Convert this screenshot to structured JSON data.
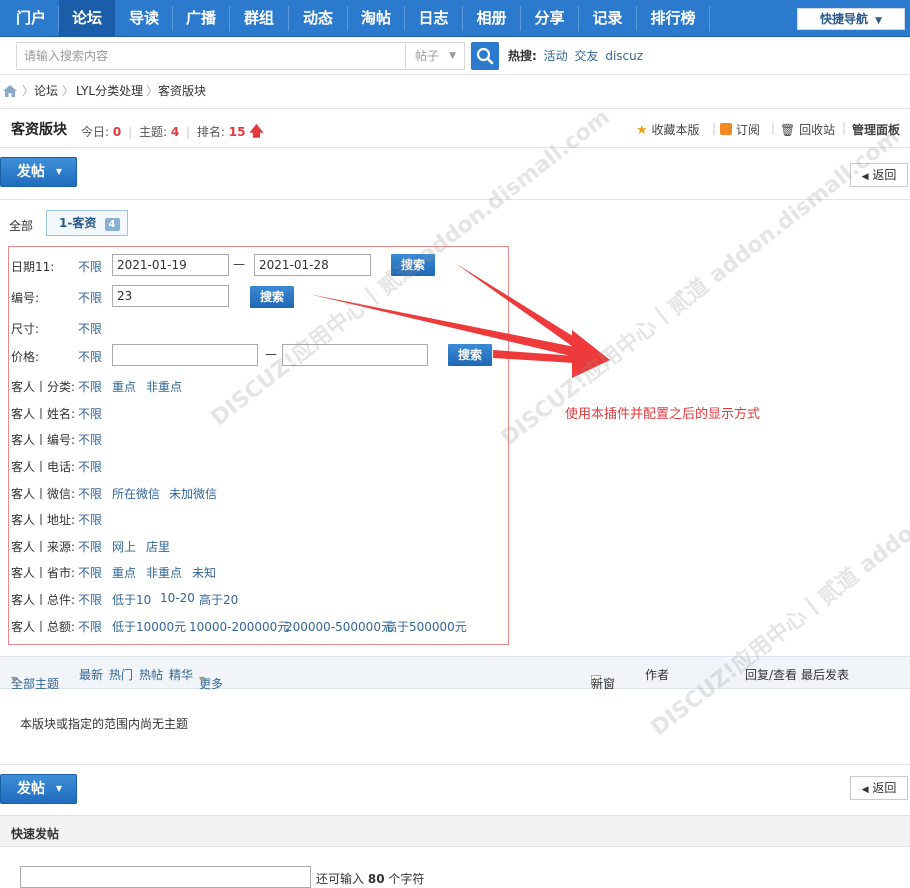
{
  "nav": {
    "items": [
      "门户",
      "论坛",
      "导读",
      "广播",
      "群组",
      "动态",
      "淘帖",
      "日志",
      "相册",
      "分享",
      "记录",
      "排行榜"
    ],
    "quick_nav": "快捷导航"
  },
  "search": {
    "placeholder": "请输入搜索内容",
    "type": "帖子",
    "hot_label": "热搜:",
    "hot_items": [
      "活动",
      "交友",
      "discuz"
    ]
  },
  "breadcrumb": [
    "论坛",
    "LYL分类处理",
    "客资版块"
  ],
  "forum": {
    "title": "客资版块",
    "today_label": "今日:",
    "today": "0",
    "topics_label": "主题:",
    "topics": "4",
    "rank_label": "排名:",
    "rank": "15",
    "favorite": "收藏本版",
    "subscribe": "订阅",
    "recycle": "回收站",
    "manage": "管理面板"
  },
  "actions": {
    "post": "发帖",
    "back": "返回"
  },
  "tabs": {
    "all": "全部",
    "current": "1-客资",
    "current_count": "4"
  },
  "filter": {
    "date": {
      "label": "日期11:",
      "any": "不限",
      "from": "2021-01-19",
      "to": "2021-01-28",
      "sep": "—",
      "search": "搜索"
    },
    "number": {
      "label": "编号:",
      "any": "不限",
      "value": "23",
      "search": "搜索"
    },
    "size": {
      "label": "尺寸:",
      "any": "不限"
    },
    "price": {
      "label": "价格:",
      "any": "不限",
      "sep": "—",
      "search": "搜索"
    },
    "rows": [
      {
        "label": "客人丨分类:",
        "options": [
          "不限",
          "重点",
          "非重点"
        ]
      },
      {
        "label": "客人丨姓名:",
        "options": [
          "不限"
        ]
      },
      {
        "label": "客人丨编号:",
        "options": [
          "不限"
        ]
      },
      {
        "label": "客人丨电话:",
        "options": [
          "不限"
        ]
      },
      {
        "label": "客人丨微信:",
        "options": [
          "不限",
          "所在微信",
          "未加微信"
        ]
      },
      {
        "label": "客人丨地址:",
        "options": [
          "不限"
        ]
      },
      {
        "label": "客人丨来源:",
        "options": [
          "不限",
          "网上",
          "店里"
        ]
      },
      {
        "label": "客人丨省市:",
        "options": [
          "不限",
          "重点",
          "非重点",
          "未知"
        ]
      },
      {
        "label": "客人丨总件:",
        "options": [
          "不限",
          "低于10",
          "10-20",
          "高于20"
        ]
      },
      {
        "label": "客人丨总额:",
        "options": [
          "不限",
          "低于10000元",
          "10000-200000元",
          "200000-500000元",
          "高于500000元"
        ]
      }
    ]
  },
  "annotation": "使用本插件并配置之后的显示方式",
  "threadlist": {
    "all_topics": "全部主题",
    "latest": "最新",
    "hot": "热门",
    "hot_posts": "热帖",
    "digest": "精华",
    "more": "更多",
    "new_window": "新窗",
    "author": "作者",
    "replies_views": "回复/查看",
    "last_post": "最后发表",
    "empty": "本版块或指定的范围内尚无主题"
  },
  "quickpost": {
    "title": "快速发帖",
    "hint_prefix": "还可输入",
    "count": "80",
    "hint_suffix": "个字符"
  },
  "watermark": "DISCUZ!应用中心丨贰道 addon.dismall.com",
  "colors": {
    "nav": "#2b7acd",
    "accent_red": "#e4393c",
    "link": "#336699"
  }
}
